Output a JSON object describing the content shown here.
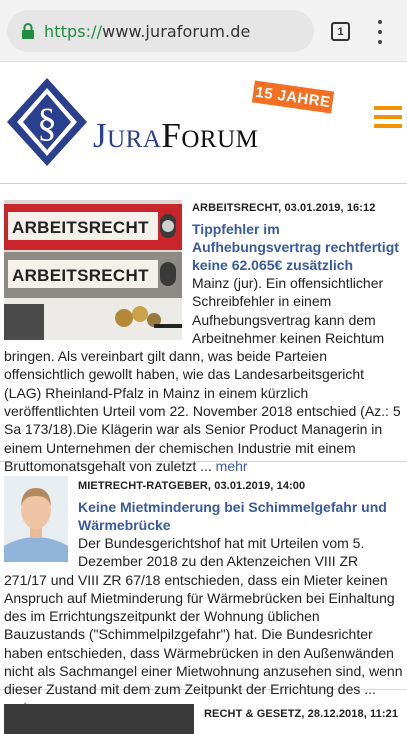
{
  "browser": {
    "url_scheme": "https://",
    "url_host": "www.juraforum.de",
    "tab_count": "1"
  },
  "site": {
    "logo_jura": "Jura",
    "logo_forum": "Forum",
    "badge": "15 JAHRE"
  },
  "articles": [
    {
      "meta": "ARBEITSRECHT, 03.01.2019, 16:12",
      "title": "Tippfehler im Aufhebungsvertrag rechtfertigt keine 62.065€ zusätzlich",
      "body": "Mainz (jur). Ein offensichtlicher Schreibfehler in einem Aufhebungsvertrag kann dem Arbeitnehmer keinen Reichtum bringen. Als vereinbart gilt dann, was beide Parteien offensichtlich gewollt haben, wie das Landesarbeitsgericht (LAG) Rheinland-Pfalz in Mainz in einem kürzlich veröffentlichten Urteil vom 22. November 2018 entschied (Az.: 5 Sa 173/18).Die Klägerin war als Senior Product Managerin in einem Unternehmen der chemischen Industrie mit einem Bruttomonatsgehalt von zuletzt ...",
      "more": "mehr",
      "image_labels": [
        "ARBEITSRECHT",
        "ARBEITSRECHT"
      ]
    },
    {
      "meta": "MIETRECHT-RATGEBER, 03.01.2019, 14:00",
      "title": "Keine Mietminderung bei Schimmelgefahr und Wärmebrücke",
      "body": "Der Bundesgerichtshof hat mit Urteilen vom 5. Dezember 2018 zu den Aktenzeichen VIII ZR 271/17 und VIII ZR 67/18 entschieden, dass ein Mieter keinen Anspruch auf Mietminderung für Wärmebrücken bei Einhaltung des im Errichtungszeitpunkt der Wohnung üblichen Bauzustands (\"Schimmelpilzgefahr\") hat. Die Bundesrichter haben entschieden, dass Wärmebrücken in den Außenwänden nicht als Sachmangel einer Mietwohnung anzusehen sind, wenn dieser Zustand mit dem zum Zeitpunkt der Errichtung des ...",
      "more": "mehr"
    },
    {
      "meta": "RECHT & GESETZ, 28.12.2018, 11:21"
    }
  ]
}
